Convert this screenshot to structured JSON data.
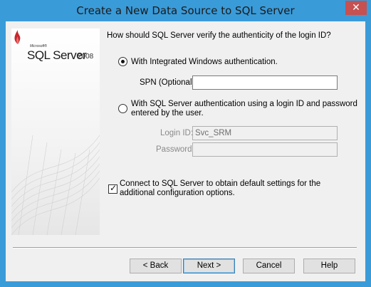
{
  "window": {
    "title": "Create a New Data Source to SQL Server",
    "close_glyph": "✕"
  },
  "logo": {
    "microsoft": "Microsoft®",
    "product": "SQL Server",
    "year": "2008"
  },
  "question": "How should SQL Server verify the authenticity of the login ID?",
  "auth_options": {
    "windows": {
      "label": "With Integrated Windows authentication.",
      "checked": true
    },
    "spn": {
      "label": "SPN (Optional):",
      "value": ""
    },
    "sql": {
      "label_line1": "With SQL Server authentication using a login ID and password",
      "label_line2": "entered by the user.",
      "checked": false
    },
    "login_id": {
      "label": "Login ID:",
      "value": "Svc_SRM"
    },
    "password": {
      "label": "Password:",
      "value": ""
    }
  },
  "connect_option": {
    "label_line1": "Connect to SQL Server to obtain default settings for the",
    "label_line2": "additional configuration options.",
    "checked": true
  },
  "buttons": {
    "back": "< Back",
    "next": "Next >",
    "cancel": "Cancel",
    "help": "Help"
  },
  "colors": {
    "title_bar": "#3a9bd9",
    "close_button": "#c75050",
    "dialog_bg": "#f0f0f0"
  }
}
